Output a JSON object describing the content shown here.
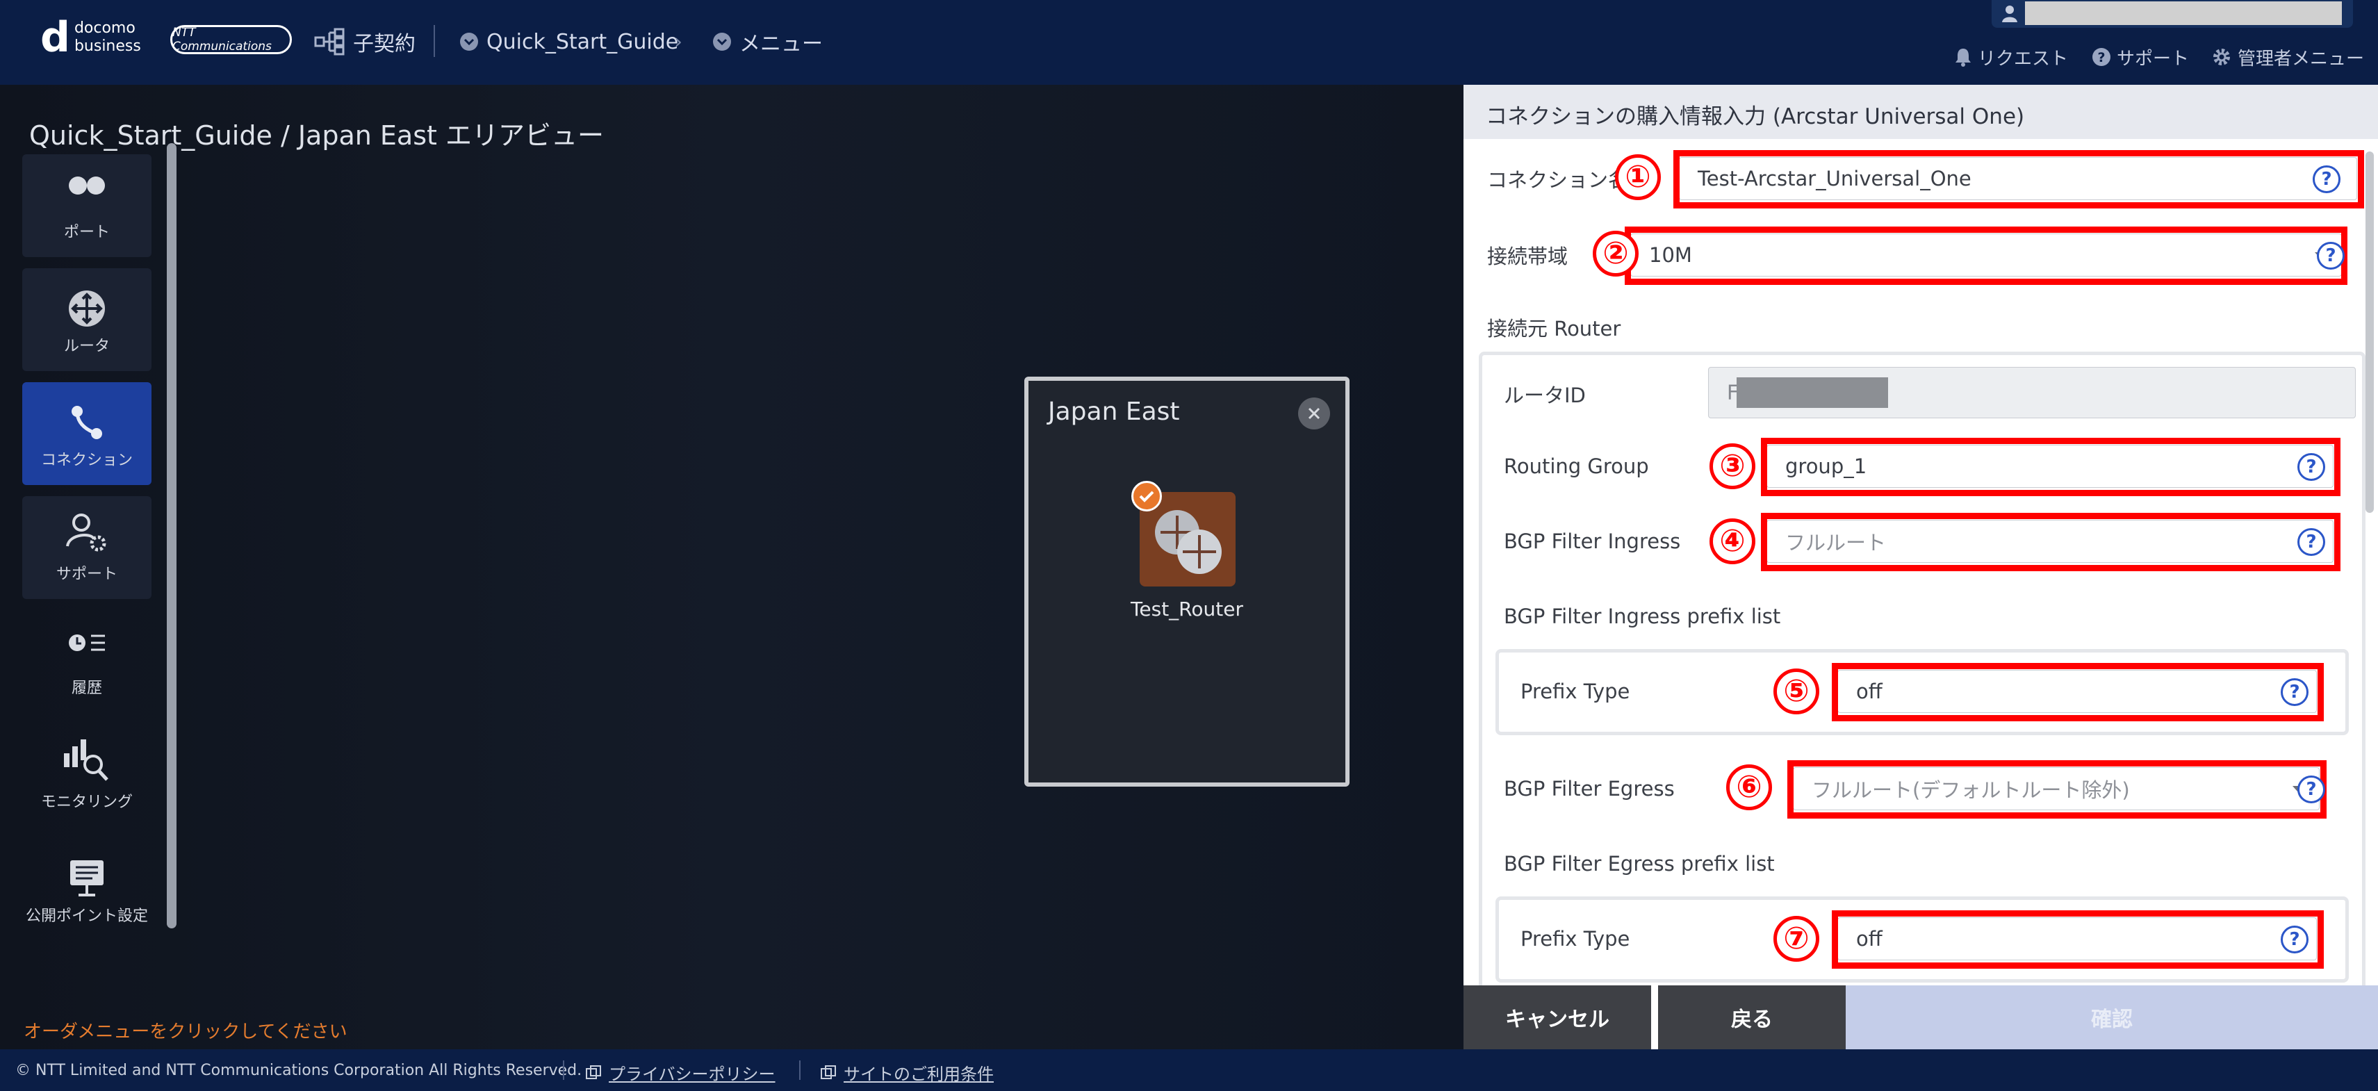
{
  "header": {
    "brand_line1": "docomo",
    "brand_line2": "business",
    "partner_logo": "NTT Communications",
    "sub_contract": "子契約",
    "breadcrumb_project": "Quick_Start_Guide",
    "breadcrumb_menu": "メニュー",
    "request": "リクエスト",
    "support": "サポート",
    "admin_menu": "管理者メニュー"
  },
  "area": {
    "title": "Quick_Start_Guide / Japan East エリアビュー",
    "order_hint": "オーダメニューをクリックしてください"
  },
  "sidebar": {
    "items": [
      {
        "label": "ポート",
        "icon": "port-icon"
      },
      {
        "label": "ルータ",
        "icon": "router-icon"
      },
      {
        "label": "コネクション",
        "icon": "connection-icon"
      },
      {
        "label": "サポート",
        "icon": "support-icon"
      },
      {
        "label": "履歴",
        "icon": "history-icon"
      },
      {
        "label": "モニタリング",
        "icon": "monitoring-icon"
      },
      {
        "label": "公開ポイント設定",
        "icon": "public-point-icon"
      }
    ]
  },
  "region": {
    "name": "Japan East",
    "router_name": "Test_Router"
  },
  "panel": {
    "title": "コネクションの購入情報入力 (Arcstar Universal One)",
    "connection_name_label": "コネクション名",
    "connection_name_value": "Test-Arcstar_Universal_One",
    "bandwidth_label": "接続帯域",
    "bandwidth_value": "10M",
    "source_router_label": "接続元 Router",
    "router_id_label": "ルータID",
    "router_id_value": "F",
    "routing_group_label": "Routing Group",
    "routing_group_value": "group_1",
    "bgp_ingress_label": "BGP Filter Ingress",
    "bgp_ingress_value": "フルルート",
    "bgp_ingress_prefix_label": "BGP Filter Ingress prefix list",
    "prefix_type_label": "Prefix Type",
    "ingress_prefix_value": "off",
    "bgp_egress_label": "BGP Filter Egress",
    "bgp_egress_value": "フルルート(デフォルトルート除外)",
    "bgp_egress_prefix_label": "BGP Filter Egress prefix list",
    "egress_prefix_value": "off",
    "help_symbol": "?",
    "markers": [
      "①",
      "②",
      "③",
      "④",
      "⑤",
      "⑥",
      "⑦"
    ]
  },
  "buttons": {
    "cancel": "キャンセル",
    "back": "戻る",
    "confirm": "確認"
  },
  "footer": {
    "copyright": "© NTT Limited and NTT Communications Corporation All Rights Reserved.",
    "privacy": "プライバシーポリシー",
    "terms": "サイトのご利用条件"
  },
  "colors": {
    "header_bg": "#0b1e46",
    "active_nav": "#1d3f9e",
    "highlight_red": "#ff0000",
    "hint_orange": "#e57c2e",
    "help_blue": "#2b56c8"
  }
}
